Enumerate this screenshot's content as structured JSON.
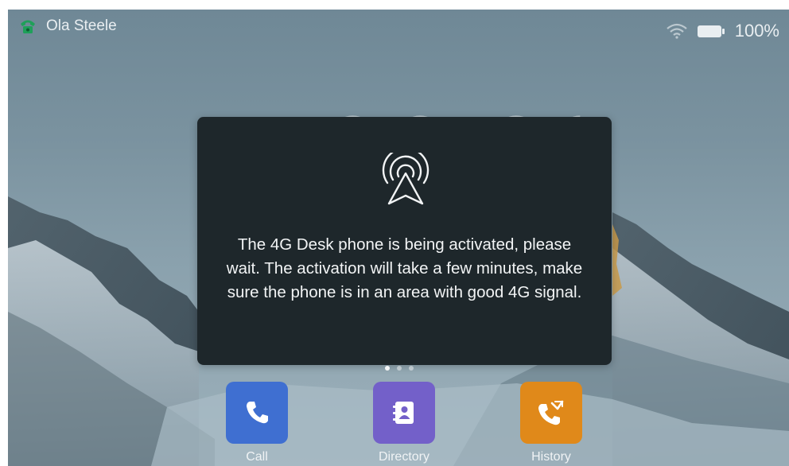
{
  "statusbar": {
    "account_name": "Ola Steele",
    "battery": "100%",
    "icons": [
      "phone-icon",
      "wifi-icon",
      "battery-icon"
    ]
  },
  "dialog": {
    "icon": "signal-tower-icon",
    "message": "The 4G Desk phone is being activated, please wait. The activation will take a few minutes, make sure the phone is in an area with good 4G signal."
  },
  "pager": {
    "pages": 3,
    "active": 0
  },
  "dock": [
    {
      "label": "Call",
      "icon": "phone-handset-icon",
      "color": "#3f6fd1"
    },
    {
      "label": "Directory",
      "icon": "contact-book-icon",
      "color": "#7360c9"
    },
    {
      "label": "History",
      "icon": "missed-call-icon",
      "color": "#e0891a"
    }
  ],
  "colors": {
    "dialog_bg": "#1e272b",
    "status_phone_icon": "#1fa05a"
  }
}
